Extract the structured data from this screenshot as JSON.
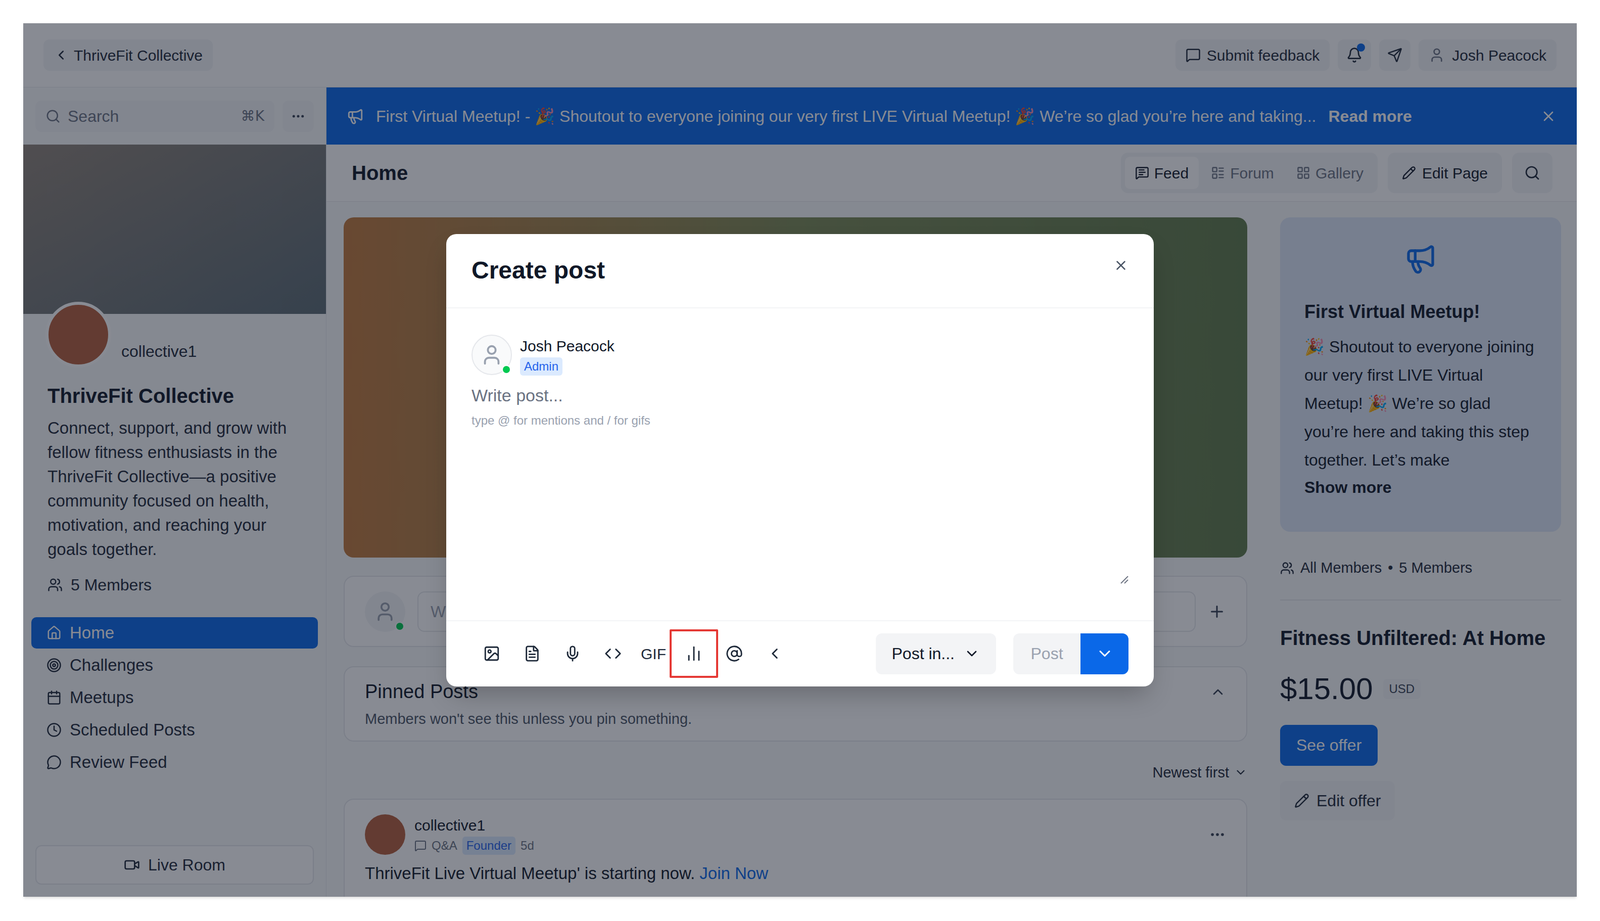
{
  "topbar": {
    "back_label": "ThriveFit Collective",
    "feedback_label": "Submit feedback",
    "notifications_unread": true,
    "user_name": "Josh Peacock"
  },
  "sidebar": {
    "search_placeholder": "Search",
    "search_shortcut": "⌘K",
    "community_handle": "collective1",
    "community_name": "ThriveFit Collective",
    "description": "Connect, support, and grow with fellow fitness enthusiasts in the ThriveFit Collective—a positive community focused on health, motivation, and reaching your goals together.",
    "members": "5 Members",
    "nav": [
      {
        "label": "Home",
        "selected": true
      },
      {
        "label": "Challenges",
        "selected": false
      },
      {
        "label": "Meetups",
        "selected": false
      },
      {
        "label": "Scheduled Posts",
        "selected": false
      },
      {
        "label": "Review Feed",
        "selected": false
      }
    ],
    "live_room": "Live Room"
  },
  "banner": {
    "text": "First Virtual Meetup! - 🎉 Shoutout to everyone joining our very first LIVE Virtual Meetup! 🎉 We’re so glad you’re here and taking...",
    "link": "Read more"
  },
  "page": {
    "title": "Home",
    "views": [
      {
        "label": "Feed",
        "selected": true
      },
      {
        "label": "Forum",
        "selected": false
      },
      {
        "label": "Gallery",
        "selected": false
      }
    ],
    "edit_label": "Edit Page"
  },
  "composer": {
    "placeholder": "W"
  },
  "pinned": {
    "title": "Pinned Posts",
    "note": "Members won't see this unless you pin something.",
    "expanded": true
  },
  "sort": {
    "label": "Newest first"
  },
  "post": {
    "author": "collective1",
    "space": "Q&A",
    "badge": "Founder",
    "time": "5d",
    "text": "ThriveFit Live Virtual Meetup' is starting now.",
    "link": "Join Now"
  },
  "announcement": {
    "title": "First Virtual Meetup!",
    "body": "🎉 Shoutout to everyone joining our very first LIVE Virtual Meetup! 🎉 We’re so glad you’re here and taking this step together. Let’s make",
    "more": "Show more"
  },
  "members": {
    "label": "All Members",
    "separator": "•",
    "count": "5 Members"
  },
  "offer": {
    "title": "Fitness Unfiltered: At Home",
    "price": "$15.00",
    "currency": "USD",
    "see_label": "See offer",
    "edit_label": "Edit offer"
  },
  "modal": {
    "title": "Create post",
    "author": "Josh Peacock",
    "role": "Admin",
    "online": true,
    "placeholder": "Write post...",
    "hint": "type @ for mentions and / for gifs",
    "tools": [
      {
        "kind": "icon",
        "highlighted": false
      },
      {
        "kind": "icon",
        "highlighted": false
      },
      {
        "kind": "icon",
        "highlighted": false
      },
      {
        "kind": "icon",
        "highlighted": false
      },
      {
        "kind": "text",
        "label": "GIF",
        "highlighted": false
      },
      {
        "kind": "icon",
        "highlighted": true
      },
      {
        "kind": "icon",
        "highlighted": false
      },
      {
        "kind": "icon",
        "highlighted": false
      }
    ],
    "post_in": "Post in...",
    "post_label": "Post",
    "post_disabled": true
  }
}
